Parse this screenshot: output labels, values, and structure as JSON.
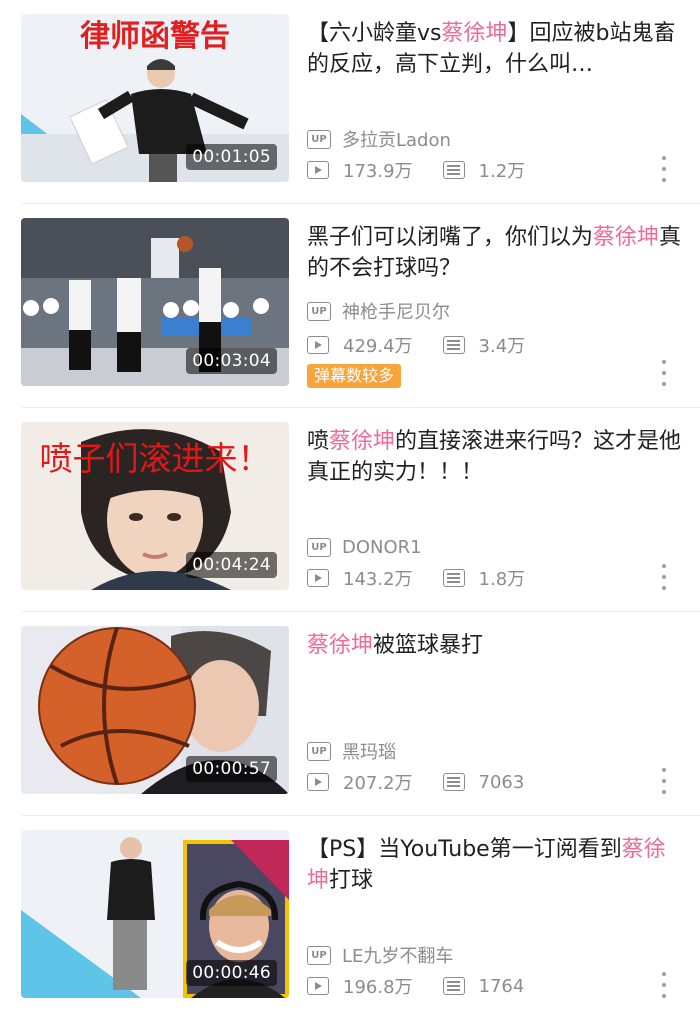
{
  "videos": [
    {
      "thumb_overlay_text": "律师函警告",
      "duration": "00:01:05",
      "title_parts": [
        "【六小龄童vs",
        "蔡徐坤",
        "】回应被b站鬼畜的反应，高下立判，什么叫…"
      ],
      "uploader": "多拉贡Ladon",
      "views": "173.9万",
      "danmaku": "1.2万"
    },
    {
      "duration": "00:03:04",
      "title_parts": [
        "黑子们可以闭嘴了，你们以为",
        "蔡徐坤",
        "真的不会打球吗？"
      ],
      "uploader": "神枪手尼贝尔",
      "views": "429.4万",
      "danmaku": "3.4万",
      "tag": "弹幕数较多"
    },
    {
      "thumb_overlay_text": "喷子们滚进来！",
      "duration": "00:04:24",
      "title_parts": [
        "喷",
        "蔡徐坤",
        "的直接滚进来行吗？这才是他真正的实力！！！"
      ],
      "uploader": "DONOR1",
      "views": "143.2万",
      "danmaku": "1.8万"
    },
    {
      "duration": "00:00:57",
      "title_parts": [
        "",
        "蔡徐坤",
        "被篮球暴打"
      ],
      "uploader": "黑玛瑙",
      "views": "207.2万",
      "danmaku": "7063"
    },
    {
      "duration": "00:00:46",
      "title_parts": [
        "【PS】当YouTube第一订阅看到",
        "蔡徐坤",
        "打球"
      ],
      "uploader": "LE九岁不翻车",
      "views": "196.8万",
      "danmaku": "1764"
    }
  ],
  "labels": {
    "up_badge": "UP"
  },
  "colors": {
    "highlight": "#f06a98",
    "meta_gray": "#8c8c8c",
    "tag_orange": "#f9a43a"
  },
  "icons": {
    "views": "play-count-icon",
    "danmaku": "danmaku-count-icon",
    "more": "more-vertical-icon"
  }
}
